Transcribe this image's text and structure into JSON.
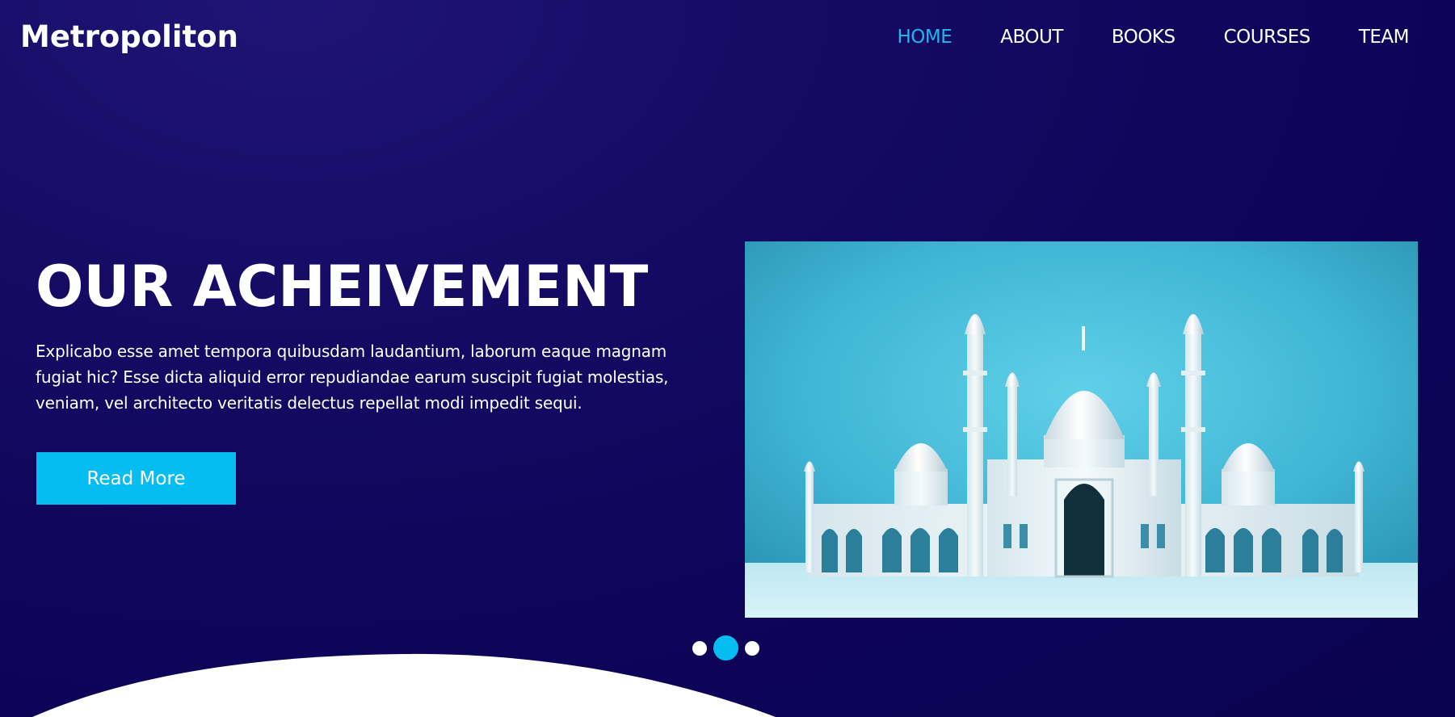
{
  "brand": {
    "name": "Metropoliton"
  },
  "nav": {
    "items": [
      {
        "label": "HOME",
        "active": true
      },
      {
        "label": "ABOUT",
        "active": false
      },
      {
        "label": "BOOKS",
        "active": false
      },
      {
        "label": "COURSES",
        "active": false
      },
      {
        "label": "TEAM",
        "active": false
      }
    ]
  },
  "hero": {
    "title": "OUR ACHEIVEMENT",
    "text": "Explicabo esse amet tempora quibusdam laudantium, laborum eaque magnam fugiat hic? Esse dicta aliquid error repudiandae earum suscipit fugiat molestias, veniam, vel architecto veritatis delectus repellat modi impedit sequi.",
    "button_label": "Read More",
    "image": "mosque-illustration"
  },
  "carousel": {
    "slides": 3,
    "active_index": 1
  },
  "colors": {
    "accent": "#06bdf2",
    "nav_active": "#1eb8ee",
    "background": "#0d0458",
    "text": "#ffffff"
  }
}
